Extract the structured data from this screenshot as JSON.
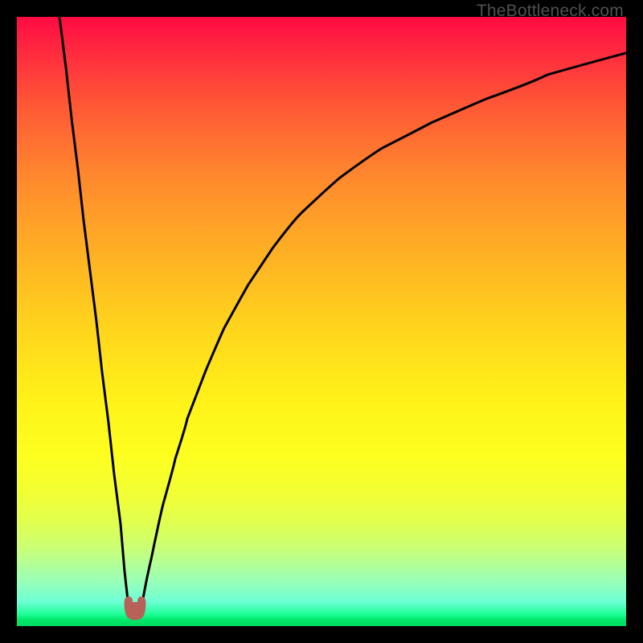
{
  "attribution": "TheBottleneck.com",
  "colors": {
    "frame": "#000000",
    "curve": "#000000",
    "marker": "#b86159"
  },
  "chart_data": {
    "type": "line",
    "title": "",
    "xlabel": "",
    "ylabel": "",
    "xlim": [
      0,
      100
    ],
    "ylim": [
      0,
      100
    ],
    "grid": false,
    "legend": false,
    "series": [
      {
        "name": "left-branch",
        "x": [
          7.0,
          8.0,
          9.0,
          10.0,
          11.0,
          12.0,
          13.0,
          14.0,
          15.0,
          16.0,
          17.0,
          17.7,
          18.3
        ],
        "y": [
          100.0,
          91.7,
          83.3,
          75.0,
          66.7,
          58.3,
          50.0,
          41.7,
          33.3,
          25.0,
          16.7,
          9.0,
          3.0
        ]
      },
      {
        "name": "right-branch",
        "x": [
          20.5,
          22.0,
          24.0,
          26.0,
          28.0,
          31.0,
          34.0,
          38.0,
          42.0,
          47.0,
          53.0,
          60.0,
          68.0,
          77.0,
          87.0,
          100.0
        ],
        "y": [
          3.0,
          11.0,
          20.0,
          27.5,
          34.0,
          42.0,
          49.0,
          56.0,
          62.0,
          68.0,
          73.5,
          78.5,
          83.0,
          87.0,
          90.5,
          94.0
        ]
      }
    ],
    "annotations": [
      {
        "name": "valley-marker",
        "shape": "u-mark",
        "x": 19.4,
        "y": 2.5,
        "color": "#b86159"
      }
    ]
  }
}
